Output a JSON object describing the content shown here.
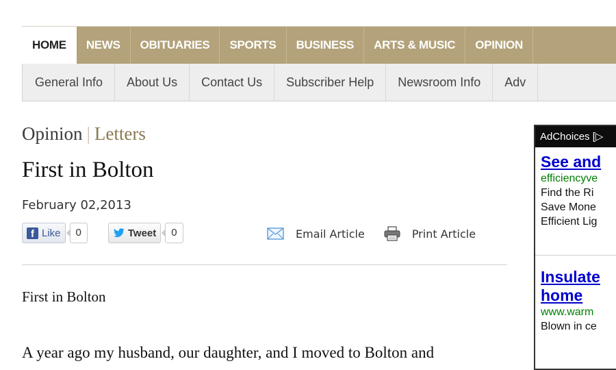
{
  "nav": {
    "primary": [
      "HOME",
      "NEWS",
      "OBITUARIES",
      "SPORTS",
      "BUSINESS",
      "ARTS & MUSIC",
      "OPINION"
    ],
    "secondary": [
      "General Info",
      "About Us",
      "Contact Us",
      "Subscriber Help",
      "Newsroom Info",
      "Adv"
    ]
  },
  "breadcrumb": {
    "section": "Opinion",
    "separator": "|",
    "subsection": "Letters"
  },
  "article": {
    "title": "First in Bolton",
    "date": "February 02,2013",
    "body_first_line": "First in Bolton",
    "body_second_line": "A year ago my husband, our daughter, and I moved to Bolton and"
  },
  "social": {
    "like_label": "Like",
    "like_count": "0",
    "tweet_label": "Tweet",
    "tweet_count": "0"
  },
  "actions": {
    "email_label": "Email Article",
    "print_label": "Print Article"
  },
  "ad": {
    "header": "AdChoices [▷",
    "units": [
      {
        "title_lines": [
          "See and"
        ],
        "url": "efficiencyve",
        "text_lines": [
          "Find the Ri",
          "Save Mone",
          "Efficient Lig"
        ]
      },
      {
        "title_lines": [
          "Insulate",
          "home"
        ],
        "url": "www.warm",
        "text_lines": [
          "Blown in ce"
        ]
      }
    ]
  },
  "colors": {
    "nav_tan": "#b3a27a",
    "subnav_bg": "#eeeeee",
    "ad_link": "#0000cc",
    "ad_url": "#008000",
    "facebook": "#3b5998",
    "twitter": "#1da1f2"
  }
}
